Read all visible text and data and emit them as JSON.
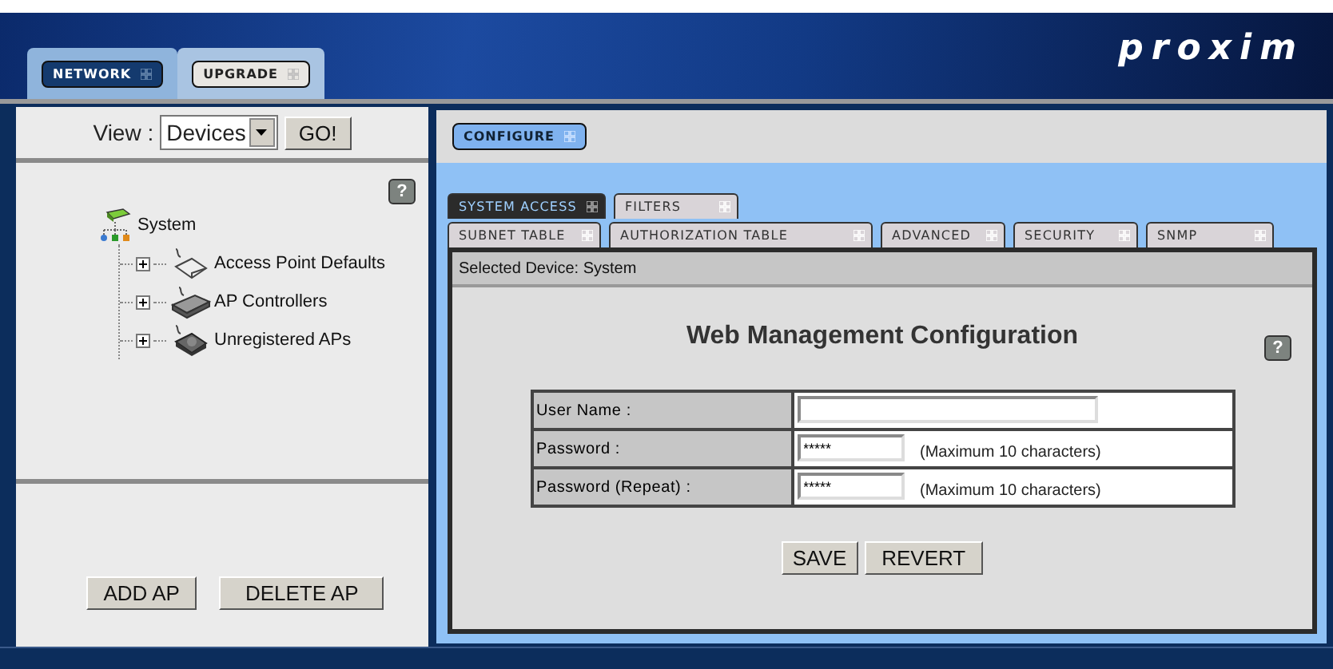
{
  "header": {
    "logo": "proxim",
    "tabs": [
      {
        "label": "NETWORK",
        "selected": true
      },
      {
        "label": "UPGRADE",
        "selected": false
      }
    ]
  },
  "left_panel": {
    "view": {
      "label": "View :",
      "value": "Devices",
      "go": "GO!"
    },
    "tree": {
      "help": "?",
      "root": {
        "label": "System",
        "kind": "network",
        "children": [
          {
            "label": "Access Point Defaults",
            "kind": "defaults",
            "expanded": false
          },
          {
            "label": "AP Controllers",
            "kind": "controller",
            "expanded": false
          },
          {
            "label": "Unregistered APs",
            "kind": "unregistered",
            "expanded": false
          }
        ]
      }
    },
    "buttons": [
      "ADD AP",
      "DELETE AP"
    ]
  },
  "right_panel": {
    "top_tabs": [
      {
        "label": "CONFIGURE",
        "selected": true
      }
    ],
    "tab_rows": [
      [
        {
          "label": "SYSTEM ACCESS",
          "selected": true
        },
        {
          "label": "FILTERS",
          "selected": false
        }
      ],
      [
        {
          "label": "SUBNET TABLE",
          "selected": false
        },
        {
          "label": "AUTHORIZATION TABLE",
          "selected": false
        },
        {
          "label": "ADVANCED",
          "selected": false
        },
        {
          "label": "SECURITY",
          "selected": false
        },
        {
          "label": "SNMP",
          "selected": false
        }
      ]
    ],
    "selected_device": "Selected Device: System",
    "form": {
      "title": "Web Management Configuration",
      "help": "?",
      "fields": [
        {
          "label": "User Name :",
          "kind": "wide"
        },
        {
          "label": "Password :",
          "value": "*****",
          "kind": "short",
          "note": "(Maximum 10 characters)"
        },
        {
          "label": "Password (Repeat) :",
          "value": "*****",
          "kind": "short",
          "note": "(Maximum 10 characters)"
        }
      ],
      "buttons": [
        "SAVE",
        "REVERT"
      ]
    }
  }
}
